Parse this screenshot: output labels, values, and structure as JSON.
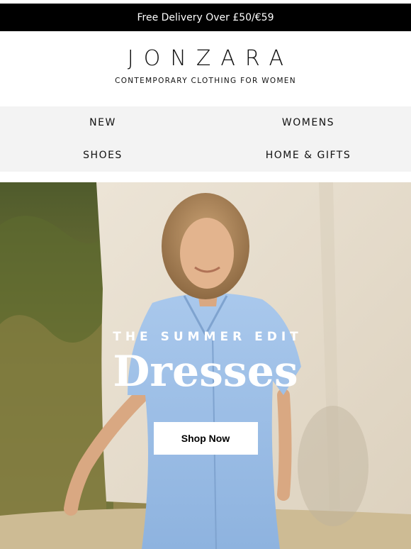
{
  "promo": {
    "text": "Free Delivery Over £50/€59"
  },
  "brand": {
    "logo": "JONZARA",
    "tagline": "CONTEMPORARY CLOTHING FOR WOMEN"
  },
  "nav": {
    "items": [
      {
        "label": "NEW"
      },
      {
        "label": "WOMENS"
      },
      {
        "label": "SHOES"
      },
      {
        "label": "HOME & GIFTS"
      }
    ]
  },
  "hero": {
    "eyebrow": "THE SUMMER EDIT",
    "headline": "Dresses",
    "cta_label": "Shop Now",
    "image_alt_subject": "woman in blue linen shirt dress",
    "colors": {
      "overlay_text": "#ffffff",
      "dress": "#9dbfe6",
      "backdrop": "#e8dfd0",
      "grass": "#6b6a35"
    }
  }
}
